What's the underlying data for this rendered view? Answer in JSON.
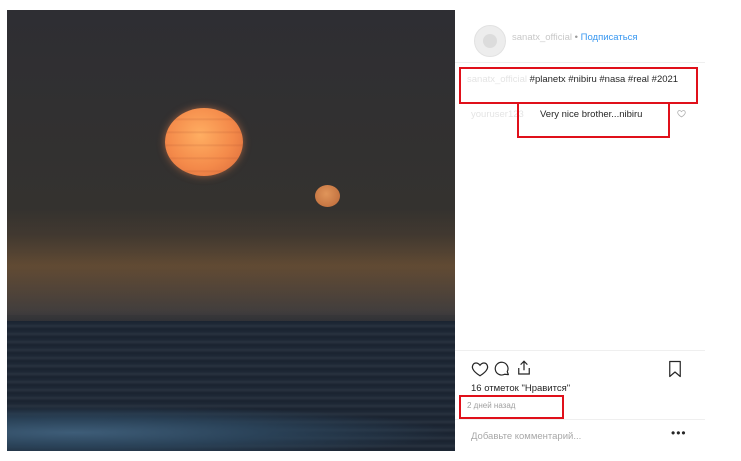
{
  "post": {
    "photo_description_icon": "sunset-image",
    "header": {
      "username": "sanatx_official",
      "separator": "•",
      "follow_label": "Подписаться"
    },
    "caption": {
      "username": "sanatx_official",
      "text": "#planetx #nibiru #nasa #real #2021"
    },
    "comment": {
      "username": "youruser123",
      "text": "Very nice brother...nibiru"
    },
    "likes_text": "16 отметок \"Нравится\"",
    "time_text": "2 дней назад",
    "add_comment_placeholder": "Добавьте комментарий...",
    "more_label": "•••"
  },
  "colors": {
    "highlight": "#e0101a",
    "follow_link": "#3897f0",
    "text": "#262626",
    "muted": "#a0a0a0"
  }
}
